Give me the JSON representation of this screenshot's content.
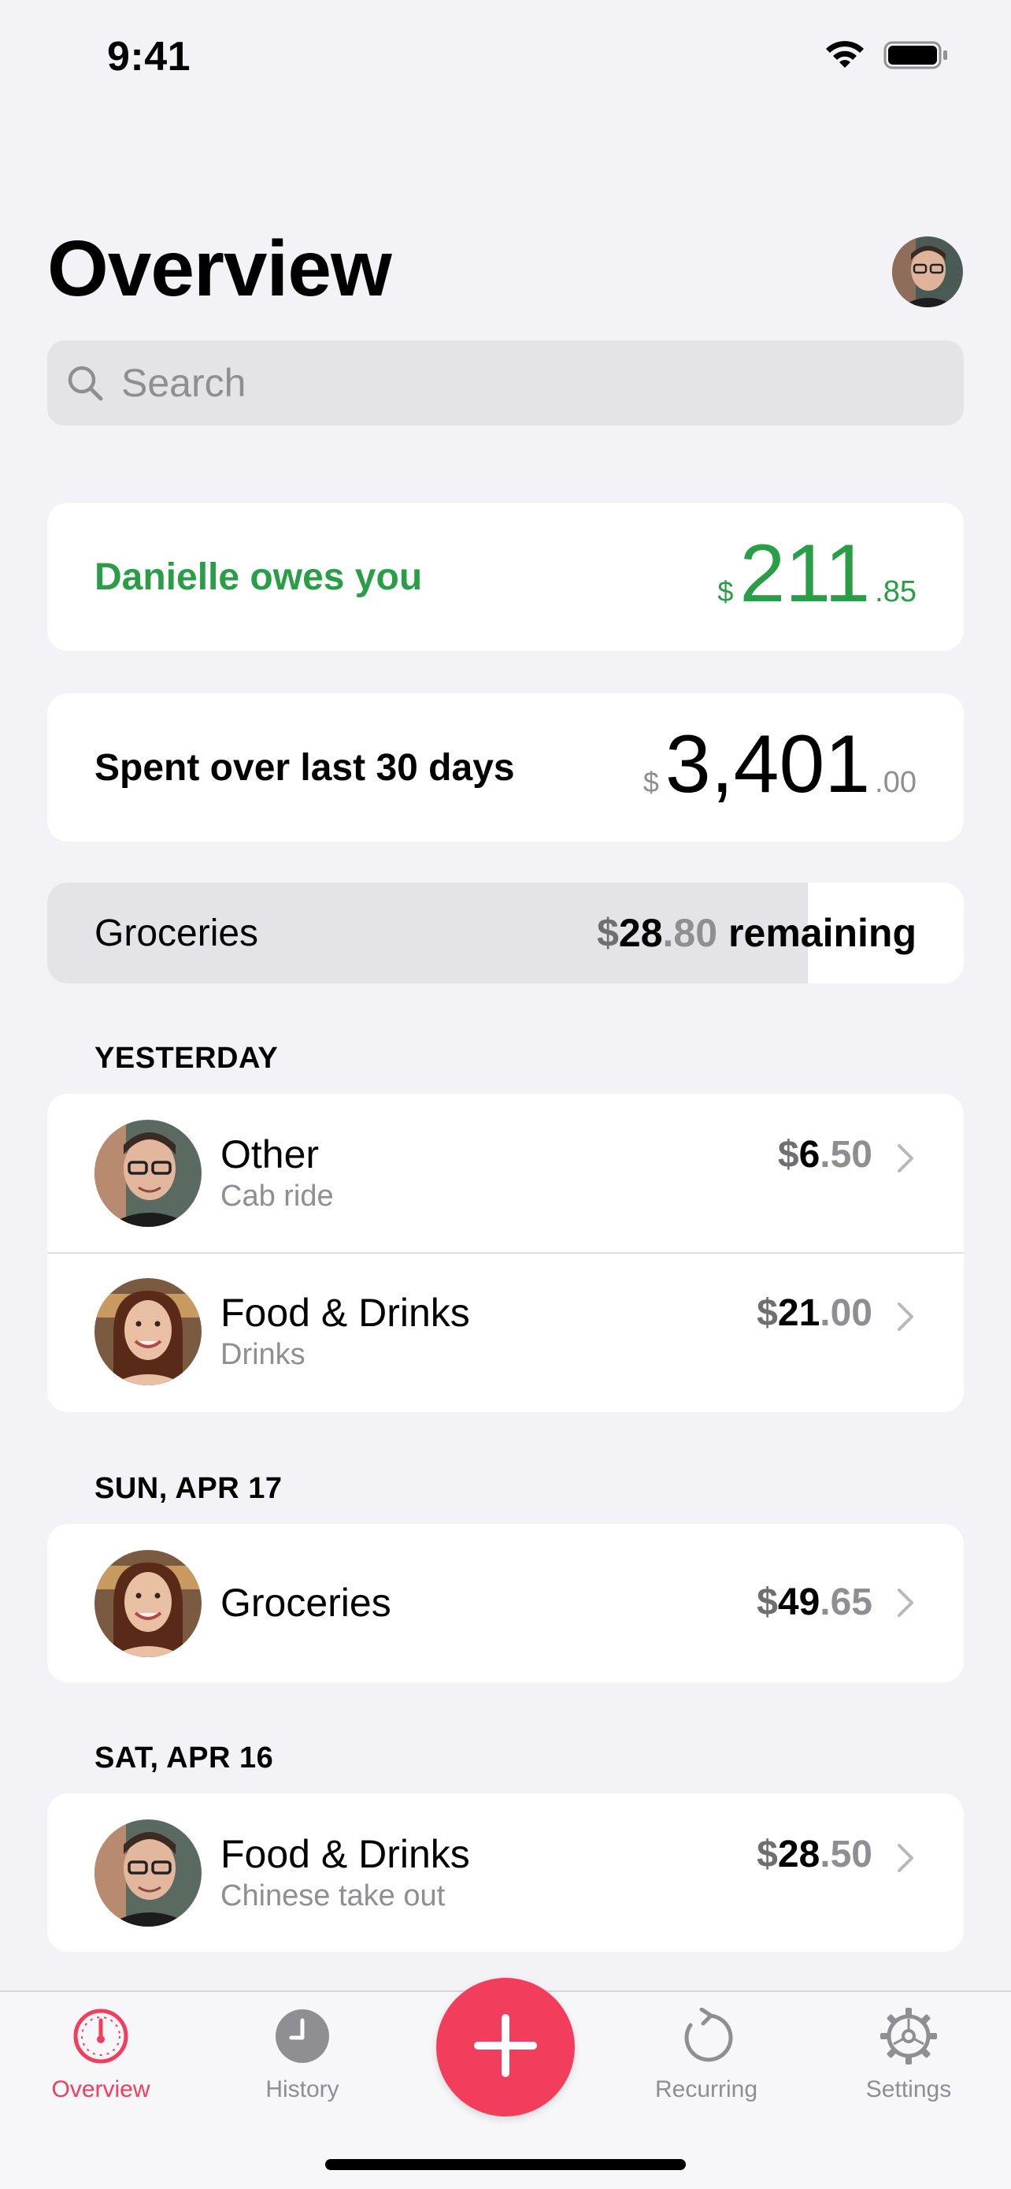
{
  "status_bar": {
    "time": "9:41"
  },
  "header": {
    "title": "Overview",
    "search_placeholder": "Search"
  },
  "balance": {
    "label": "Danielle owes you",
    "currency": "$",
    "whole": "211",
    "fraction": ".85"
  },
  "spent": {
    "label": "Spent over last 30 days",
    "currency": "$",
    "whole": "3,401",
    "fraction": ".00"
  },
  "budget": {
    "category": "Groceries",
    "dollar": "$",
    "whole": "28",
    "fraction": ".80",
    "suffix": "remaining",
    "spent_fraction": 0.83
  },
  "sections": [
    {
      "header": "YESTERDAY",
      "items": [
        {
          "title": "Other",
          "subtitle": "Cab ride",
          "dollar": "$",
          "whole": "6",
          "fraction": ".50",
          "avatar": "man"
        },
        {
          "title": "Food & Drinks",
          "subtitle": "Drinks",
          "dollar": "$",
          "whole": "21",
          "fraction": ".00",
          "avatar": "woman"
        }
      ]
    },
    {
      "header": "SUN, APR 17",
      "items": [
        {
          "title": "Groceries",
          "subtitle": "",
          "dollar": "$",
          "whole": "49",
          "fraction": ".65",
          "avatar": "woman"
        }
      ]
    },
    {
      "header": "SAT, APR 16",
      "items": [
        {
          "title": "Food & Drinks",
          "subtitle": "Chinese take out",
          "dollar": "$",
          "whole": "28",
          "fraction": ".50",
          "avatar": "man"
        }
      ]
    }
  ],
  "tab_bar": {
    "tabs": [
      {
        "label": "Overview",
        "icon": "gauge-icon",
        "active": true
      },
      {
        "label": "History",
        "icon": "clock-icon",
        "active": false
      },
      {
        "label": "Recurring",
        "icon": "repeat-icon",
        "active": false
      },
      {
        "label": "Settings",
        "icon": "gear-icon",
        "active": false
      }
    ],
    "add_icon": "plus-icon"
  },
  "colors": {
    "accent": "#F23E5C",
    "positive": "#2A9D47",
    "background": "#F2F2F7",
    "secondary_text": "#8E8E93"
  }
}
